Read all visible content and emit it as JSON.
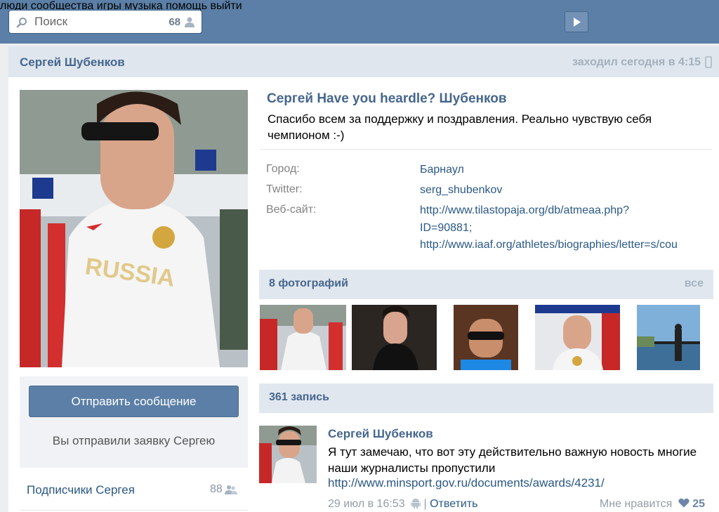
{
  "search": {
    "placeholder": "Поиск",
    "count": "68"
  },
  "nav": {
    "items": [
      "люди",
      "сообщества",
      "игры",
      "музыка",
      "помощь",
      "выйти"
    ]
  },
  "header": {
    "name": "Сергей Шубенков",
    "last_seen": "заходил сегодня в 4:15"
  },
  "left": {
    "send_message": "Отправить сообщение",
    "request_sent": "Вы отправили заявку Сергею",
    "followers_label": "Подписчики Сергея",
    "followers_count": "88"
  },
  "profile": {
    "full_name": "Сергей Have you heardle? Шубенков",
    "status": "Спасибо всем за поддержку и поздравления. Реально чувствую себя чемпионом :-)",
    "fields": [
      {
        "label": "Город:",
        "value": "Барнаул"
      },
      {
        "label": "Twitter:",
        "value": "serg_shubenkov"
      },
      {
        "label": "Веб-сайт:",
        "value": "http://www.tilastopaja.org/db/atmeaa.php?",
        "value2": "ID=90881;",
        "value3": "http://www.iaaf.org/athletes/biographies/letter=s/cou"
      }
    ]
  },
  "photos": {
    "title": "8 фотографий",
    "all": "все"
  },
  "wall": {
    "title": "361 запись"
  },
  "post": {
    "author": "Сергей Шубенков",
    "text": "Я тут замечаю, что вот эту действительно важную новость многие наши журналисты пропустили",
    "link": "http://www.minsport.gov.ru/documents/awards/4231/",
    "date": "29 июл в 16:53",
    "reply": "Ответить",
    "like_label": "Мне нравится",
    "like_count": "25"
  },
  "colors": {
    "topbar": "#5b7fa6",
    "link": "#2a5885",
    "header_text": "#45668e"
  }
}
